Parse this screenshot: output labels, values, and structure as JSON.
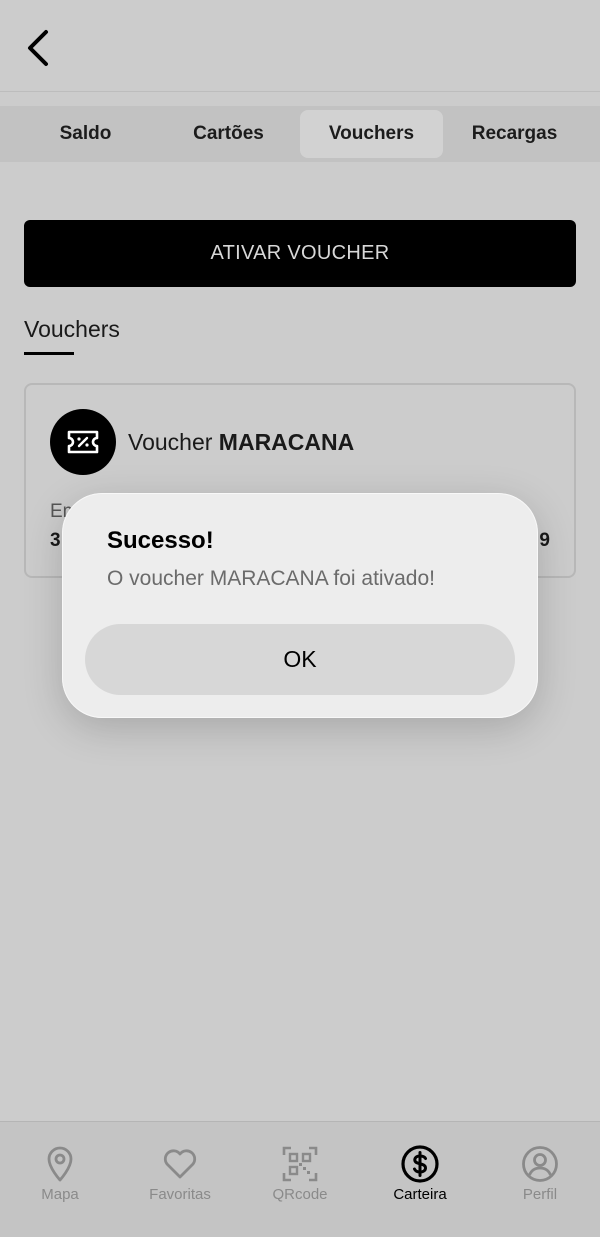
{
  "header": {
    "back_icon": "chevron-left-icon"
  },
  "tabs": [
    {
      "label": "Saldo",
      "active": false
    },
    {
      "label": "Cartões",
      "active": false
    },
    {
      "label": "Vouchers",
      "active": true
    },
    {
      "label": "Recargas",
      "active": false
    }
  ],
  "activate_button": {
    "label": "ATIVAR VOUCHER"
  },
  "section": {
    "title": "Vouchers"
  },
  "voucher": {
    "icon": "ticket-percent-icon",
    "prefix": "Voucher",
    "name": "MARACANA",
    "left_label": "Em",
    "left_value": "3",
    "right_value": "9"
  },
  "alert": {
    "title": "Sucesso!",
    "message": "O voucher MARACANA foi ativado!",
    "ok_label": "OK"
  },
  "nav": [
    {
      "label": "Mapa",
      "icon": "map-pin-icon",
      "active": false
    },
    {
      "label": "Favoritas",
      "icon": "heart-icon",
      "active": false
    },
    {
      "label": "QRcode",
      "icon": "qrcode-icon",
      "active": false
    },
    {
      "label": "Carteira",
      "icon": "dollar-circle-icon",
      "active": true
    },
    {
      "label": "Perfil",
      "icon": "user-circle-icon",
      "active": false
    }
  ],
  "colors": {
    "background": "#cccccc",
    "primary_button": "#000000",
    "alert_background": "#ededed",
    "nav_inactive": "#8a8a8a"
  }
}
